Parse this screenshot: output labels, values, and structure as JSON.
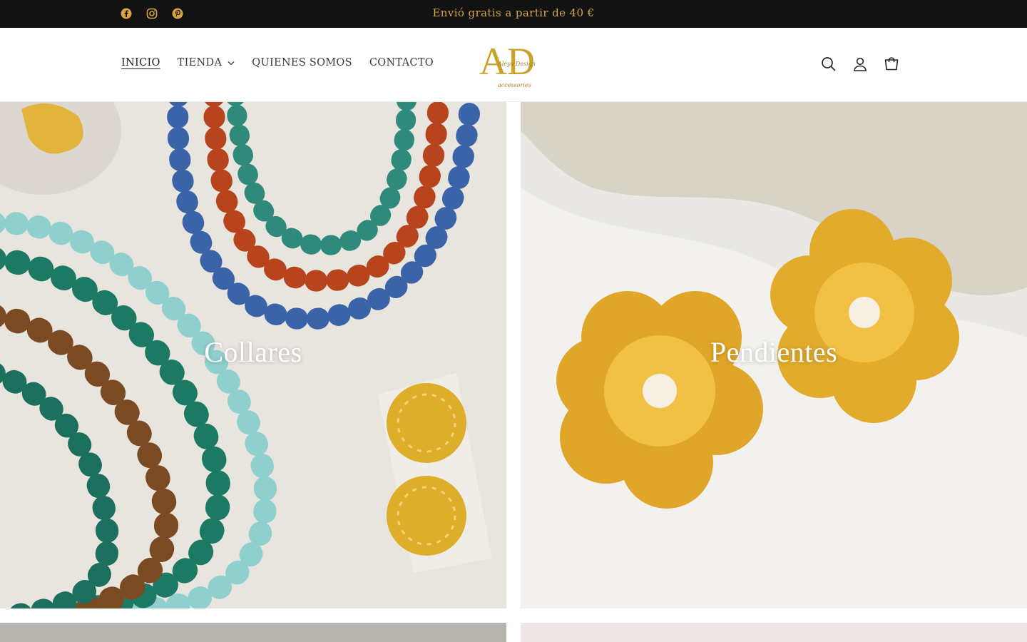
{
  "announcement": {
    "text": "Envió gratis a partir de  40 €",
    "social_icons": [
      "facebook-icon",
      "instagram-icon",
      "pinterest-icon"
    ]
  },
  "header": {
    "nav": [
      {
        "label": "INICIO",
        "active": true
      },
      {
        "label": "TIENDA",
        "has_dropdown": true
      },
      {
        "label": "QUIENES SOMOS"
      },
      {
        "label": "CONTACTO"
      }
    ],
    "logo": {
      "monogram": "AD",
      "script": "Aleya Design",
      "tagline": "accessories"
    },
    "icons": [
      "search-icon",
      "account-icon",
      "cart-icon"
    ]
  },
  "collections": [
    {
      "title": "Collares"
    },
    {
      "title": "Pendientes"
    }
  ],
  "colors": {
    "announcement_bg": "#121212",
    "announcement_text": "#d7a544",
    "brand_gold": "#c9a227",
    "nav_text": "#3b3b3b"
  }
}
